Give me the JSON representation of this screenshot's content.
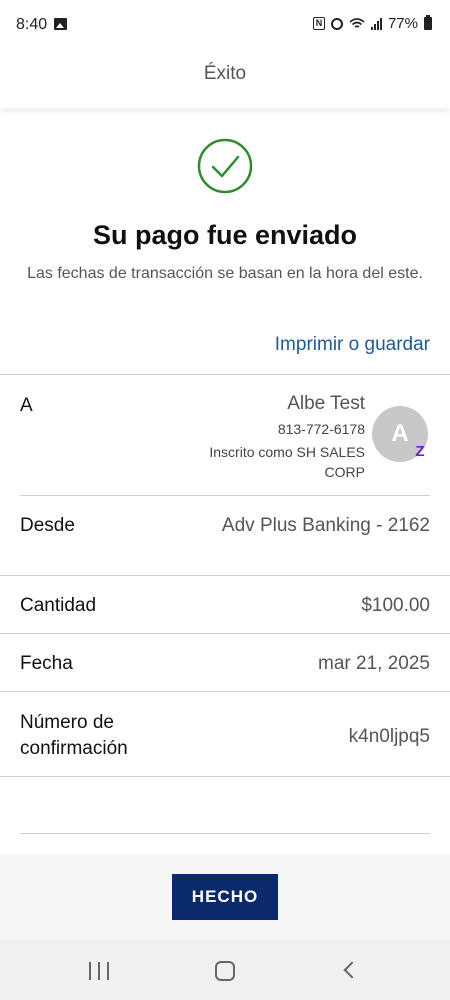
{
  "status_bar": {
    "time": "8:40",
    "battery": "77%",
    "nfc_glyph": "N"
  },
  "header": {
    "title": "Éxito"
  },
  "success": {
    "title": "Su pago fue enviado",
    "subtitle": "Las fechas de transacción se basan en la hora del este.",
    "print_link": "Imprimir o guardar",
    "icon_color": "#2e8b2e"
  },
  "details": {
    "recipient": {
      "label": "A",
      "name": "Albe Test",
      "phone": "813-772-6178",
      "enrolled": "Inscrito como SH SALES CORP",
      "avatar_initial": "A",
      "zelle_glyph": "Z"
    },
    "from": {
      "label": "Desde",
      "value": "Adv Plus Banking - 2162"
    },
    "amount": {
      "label": "Cantidad",
      "value": "$100.00"
    },
    "date": {
      "label": "Fecha",
      "value": "mar 21, 2025"
    },
    "confirmation": {
      "label": "Número de confirmación",
      "value": "k4n0ljpq5"
    }
  },
  "footer": {
    "done_label": "HECHO",
    "button_color": "#0b2a6b"
  },
  "icons": {
    "status": [
      "gallery-icon",
      "nfc-icon",
      "alarm-icon",
      "wifi-icon",
      "signal-icon",
      "battery-icon"
    ],
    "navigation": [
      "recents-icon",
      "home-icon",
      "back-icon"
    ],
    "brand": [
      "zelle-icon"
    ]
  }
}
